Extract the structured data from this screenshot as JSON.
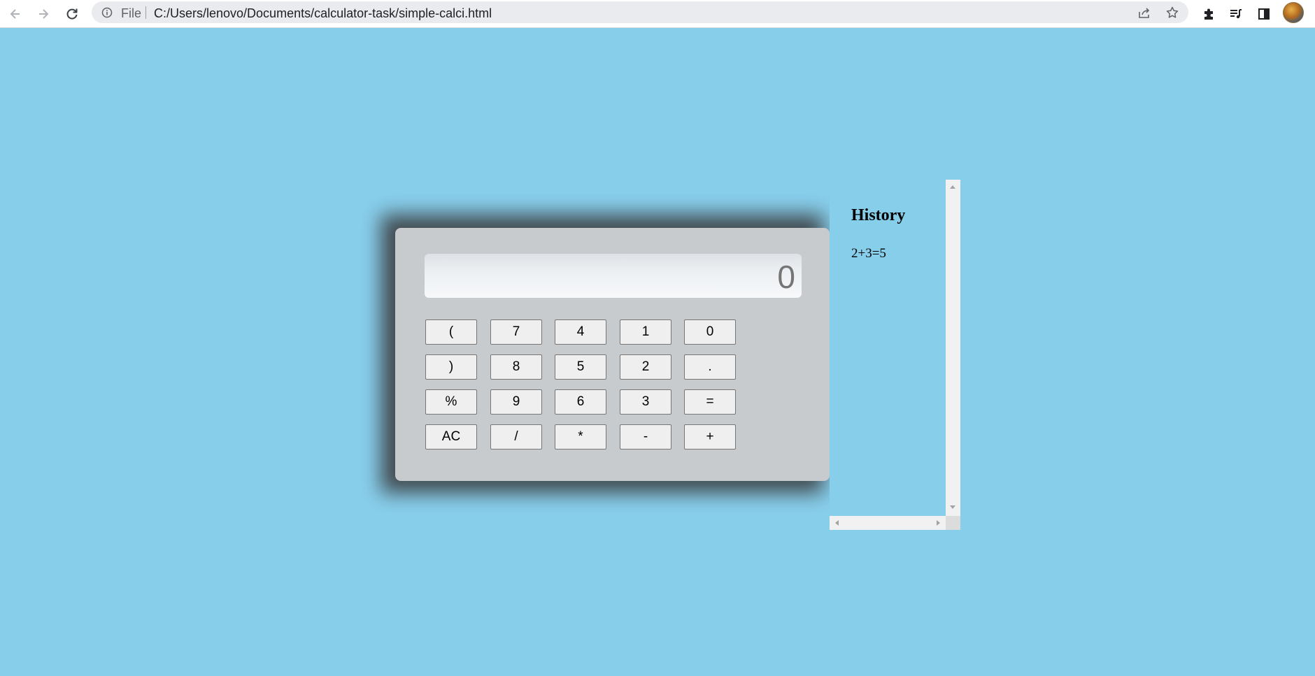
{
  "browser": {
    "file_label": "File",
    "url": "C:/Users/lenovo/Documents/calculator-task/simple-calci.html"
  },
  "calculator": {
    "display": "0",
    "keys": [
      {
        "label": "(",
        "name": "key-open-paren"
      },
      {
        "label": "7",
        "name": "key-7"
      },
      {
        "label": "4",
        "name": "key-4"
      },
      {
        "label": "1",
        "name": "key-1"
      },
      {
        "label": "0",
        "name": "key-0"
      },
      {
        "label": ")",
        "name": "key-close-paren"
      },
      {
        "label": "8",
        "name": "key-8"
      },
      {
        "label": "5",
        "name": "key-5"
      },
      {
        "label": "2",
        "name": "key-2"
      },
      {
        "label": ".",
        "name": "key-decimal"
      },
      {
        "label": "%",
        "name": "key-percent"
      },
      {
        "label": "9",
        "name": "key-9"
      },
      {
        "label": "6",
        "name": "key-6"
      },
      {
        "label": "3",
        "name": "key-3"
      },
      {
        "label": "=",
        "name": "key-equals"
      },
      {
        "label": "AC",
        "name": "key-clear"
      },
      {
        "label": "/",
        "name": "key-divide"
      },
      {
        "label": "*",
        "name": "key-multiply"
      },
      {
        "label": "-",
        "name": "key-subtract"
      },
      {
        "label": "+",
        "name": "key-add"
      }
    ]
  },
  "history": {
    "title": "History",
    "entries": [
      "2+3=5"
    ]
  },
  "colors": {
    "page_background": "#87ceeb",
    "calculator_body": "#c8cbce",
    "key_background": "#efefef"
  }
}
